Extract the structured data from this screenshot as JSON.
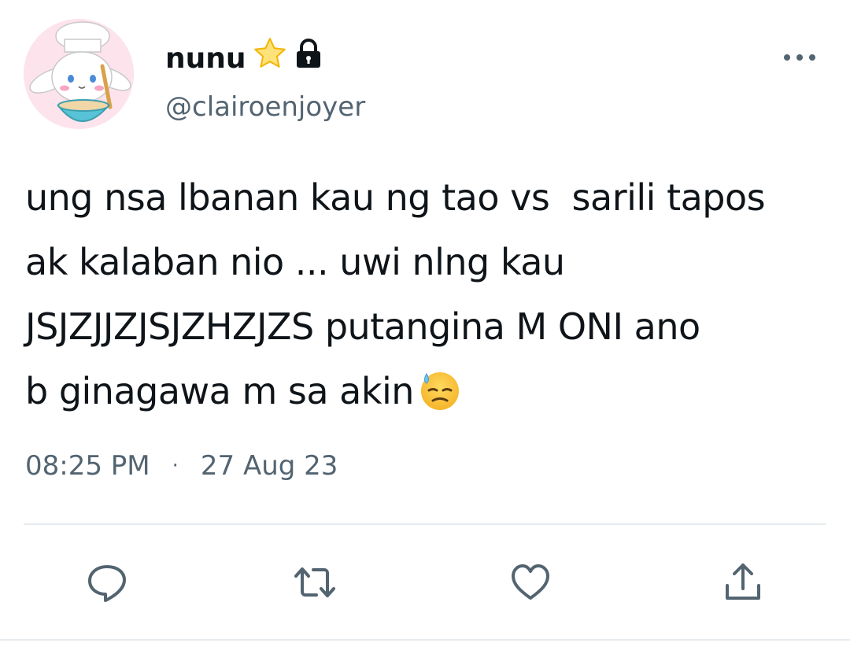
{
  "author": {
    "display_name": "nunu",
    "handle": "@clairoenjoyer",
    "badges": [
      "star-icon",
      "lock-icon"
    ],
    "avatar": "cinnamoroll-chef-avatar"
  },
  "tweet": {
    "lines": [
      "ung nsa lbanan kau ng tao vs  sarili tapos",
      "ak kalaban nio ... uwi nlng kau",
      "JSJZJJZJSJZHZJZS putangina M ONI ano",
      "b ginagawa m sa akin"
    ],
    "emoji": "downcast-face-with-sweat-emoji",
    "time": "08:25 PM",
    "separator": "·",
    "date": "27 Aug 23"
  },
  "actions": [
    "reply-icon",
    "retweet-icon",
    "like-icon",
    "share-icon"
  ],
  "colors": {
    "text": "#0f1419",
    "secondary": "#536471",
    "divider": "#e6ecf0",
    "icon": "#536471"
  }
}
